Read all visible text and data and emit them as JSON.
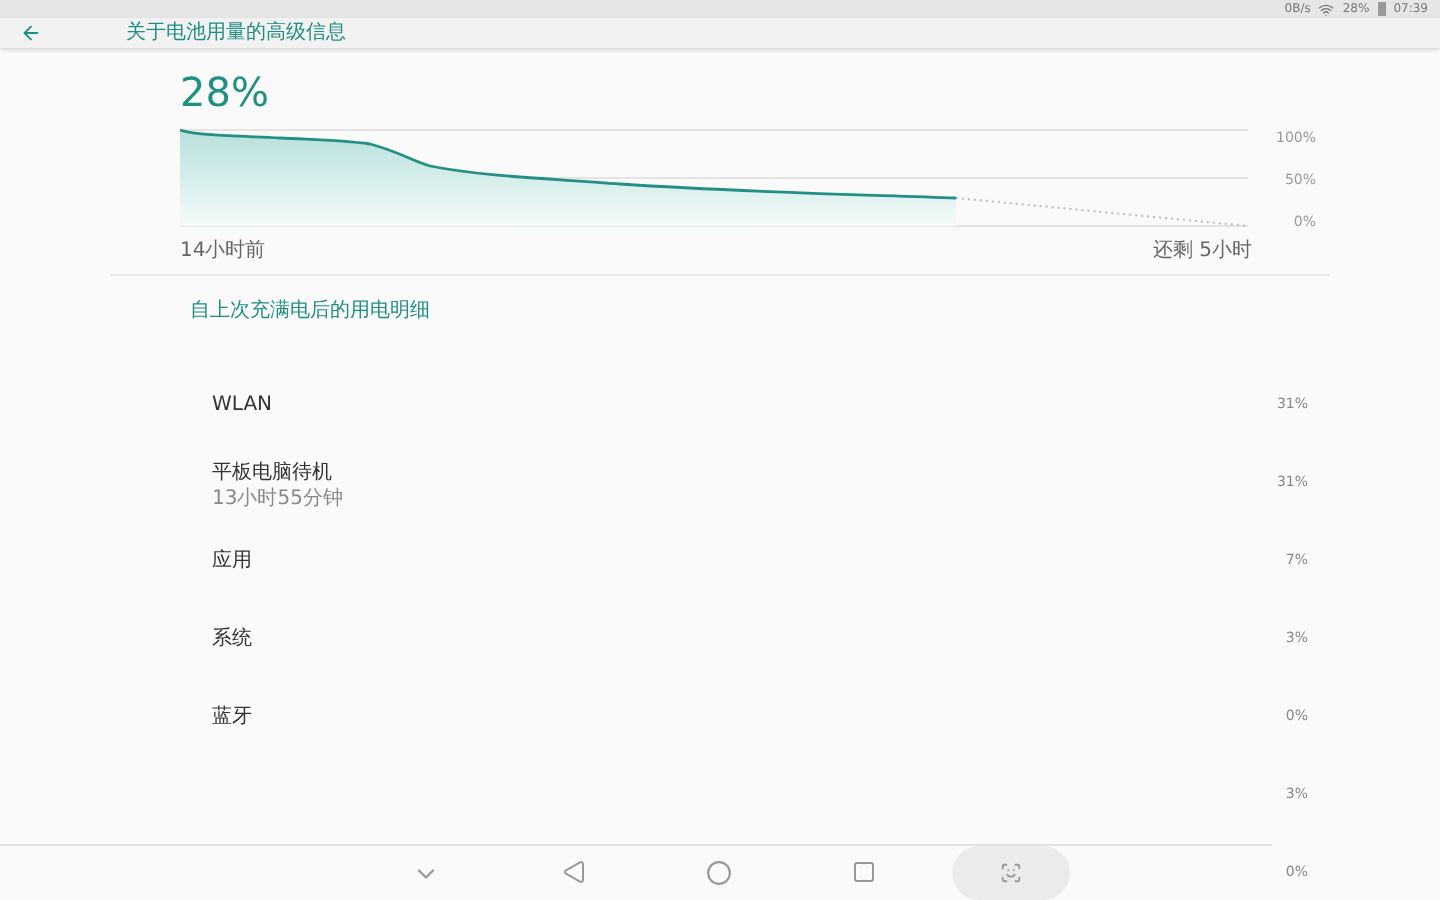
{
  "status_bar": {
    "speed": "0B/s",
    "battery": "28%",
    "time": "07:39"
  },
  "header": {
    "title": "关于电池用量的高级信息"
  },
  "battery": {
    "percent": "28%",
    "axis_labels": [
      "100%",
      "50%",
      "0%"
    ],
    "start_label": "14小时前",
    "end_label": "还剩 5小时"
  },
  "section": {
    "title": "自上次充满电后的用电明细"
  },
  "items": [
    {
      "label": "WLAN",
      "percent": "31%"
    },
    {
      "label": "平板电脑待机",
      "detail": "13小时55分钟",
      "percent": "31%"
    },
    {
      "label": "应用",
      "percent": "7%"
    },
    {
      "label": "系统",
      "percent": "3%"
    },
    {
      "label": "蓝牙",
      "percent": "0%"
    },
    {
      "percent": "3%"
    },
    {
      "percent": "0%"
    }
  ]
}
